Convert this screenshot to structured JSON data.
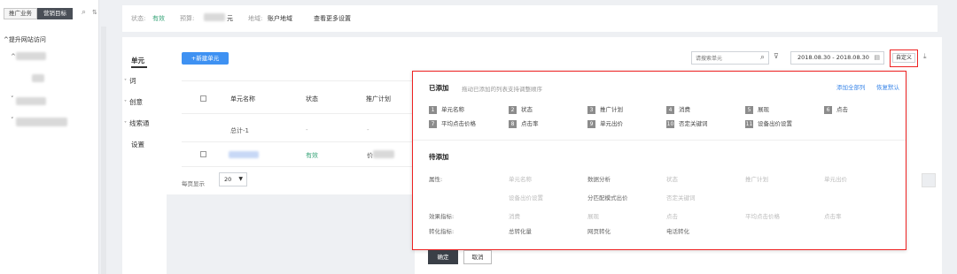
{
  "sidebar": {
    "tabs": [
      "推广业务",
      "营销目标"
    ],
    "tree_root": "^提升网站访问"
  },
  "topbar": {
    "status_key": "状态:",
    "status_val": "有效",
    "budget_key": "预算:",
    "budget_unit": "元",
    "region_key": "地域:",
    "region_val": "账户地域",
    "more_link": "查看更多设置"
  },
  "nav": {
    "items": [
      "单元",
      "词",
      "创意",
      "线索通",
      "设置"
    ]
  },
  "toolbar": {
    "new_unit": "+新建单元",
    "search_placeholder": "请搜索单元",
    "date_range": "2018.08.30 - 2018.08.30",
    "custom": "自定义"
  },
  "table": {
    "headers": [
      "单元名称",
      "状态",
      "推广计划"
    ],
    "total_label": "总计-1",
    "dash": "-",
    "row_status": "有效",
    "row_plan_prefix": "价"
  },
  "pager": {
    "label": "每页显示",
    "size": "20"
  },
  "panel": {
    "added_title": "已添加",
    "added_hint": "拖动已添加的列表支持调整顺序",
    "add_all": "添加全部列",
    "restore_default": "恢复默认",
    "added_items": [
      {
        "n": "1",
        "label": "单元名称"
      },
      {
        "n": "2",
        "label": "状态"
      },
      {
        "n": "3",
        "label": "推广计划"
      },
      {
        "n": "4",
        "label": "消费"
      },
      {
        "n": "5",
        "label": "展现"
      },
      {
        "n": "6",
        "label": "点击"
      },
      {
        "n": "7",
        "label": "平均点击价格"
      },
      {
        "n": "8",
        "label": "点击率"
      },
      {
        "n": "9",
        "label": "单元出价"
      },
      {
        "n": "10",
        "label": "否定关键词"
      },
      {
        "n": "11",
        "label": "设备出价设置"
      }
    ],
    "pending_title": "待添加",
    "attr_label": "属性:",
    "attr_options": [
      "单元名称",
      "数据分析",
      "状态",
      "推广计划",
      "单元出价",
      "设备出价设置",
      "分匹配模式出价",
      "否定关键词"
    ],
    "effect_label": "效果指标:",
    "effect_options": [
      "消费",
      "展现",
      "点击",
      "平均点击价格",
      "点击率"
    ],
    "convert_label": "转化指标:",
    "convert_options": [
      "总转化量",
      "网页转化",
      "电话转化"
    ]
  },
  "footer": {
    "confirm": "确定",
    "cancel": "取消"
  }
}
